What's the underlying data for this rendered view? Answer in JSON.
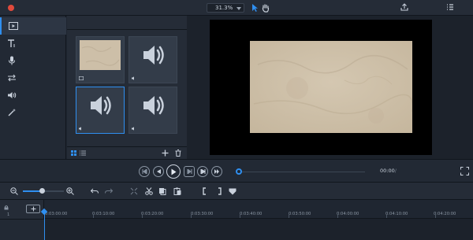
{
  "app": {
    "title": "",
    "zoom": "31.3%",
    "export_label": "",
    "properties_label": ""
  },
  "nav": {
    "items": [
      {
        "label": "",
        "icon": "media-icon",
        "active": true
      },
      {
        "label": "",
        "icon": "text-icon",
        "active": false
      },
      {
        "label": "",
        "icon": "microphone-icon",
        "active": false
      },
      {
        "label": "",
        "icon": "transition-icon",
        "active": false
      },
      {
        "label": "",
        "icon": "audio-icon",
        "active": false
      },
      {
        "label": "",
        "icon": "effects-icon",
        "active": false
      }
    ]
  },
  "media": {
    "header": "",
    "items": [
      {
        "caption": "",
        "type": "image"
      },
      {
        "caption": "",
        "type": "audio"
      },
      {
        "caption": "",
        "type": "audio",
        "selected": true
      },
      {
        "caption": "",
        "type": "audio"
      }
    ]
  },
  "playback": {
    "current_time": "00:00",
    "total_time": "",
    "progress": 0
  },
  "timeline": {
    "track_number": "1",
    "ticks": [
      "0:03:00:00",
      "0:03:10:00",
      "0:03:20:00",
      "0:03:30:00",
      "0:03:40:00",
      "0:03:50:00",
      "0:04:00:00",
      "0:04:10:00",
      "0:04:20:00"
    ]
  },
  "colors": {
    "accent": "#2f8ff0",
    "record": "#e04a3c",
    "background": "#1f2631",
    "panel": "#252c37",
    "canvas": "#000000",
    "image_tone": "#cdbfa8"
  }
}
